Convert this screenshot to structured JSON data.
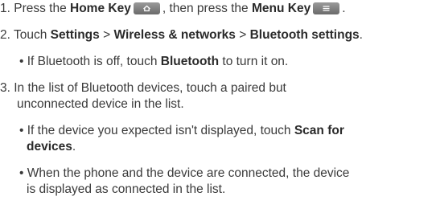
{
  "s1": {
    "a": "1. Press the ",
    "home": "Home Key",
    "b": ", then press the ",
    "menu": "Menu Key",
    "c": "."
  },
  "s2": {
    "a": "2. Touch ",
    "settings": "Settings",
    "sep1": " > ",
    "wireless": "Wireless & networks",
    "sep2": " > ",
    "bt": "Bluetooth settings",
    "c": "."
  },
  "b1": {
    "a": "• If Bluetooth is off, touch ",
    "bt": "Bluetooth",
    "c": " to turn it on."
  },
  "s3": {
    "l1": "3. In the list of Bluetooth devices, touch a paired but",
    "l2": "unconnected device in the list."
  },
  "b2": {
    "l1a": "• If the device you expected isn't displayed, touch ",
    "scan1": "Scan for",
    "scan2": "devices",
    "c": "."
  },
  "b3": {
    "l1": "• When the phone and the device are connected, the device",
    "l2": "is displayed as connected in the list."
  },
  "icons": {
    "home_key": "home-key-icon",
    "menu_key": "menu-key-icon"
  }
}
